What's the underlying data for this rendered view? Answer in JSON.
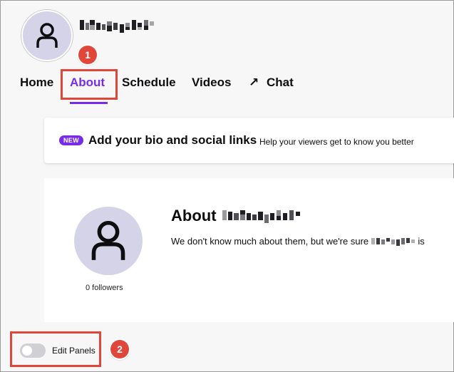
{
  "header": {
    "avatar_icon": "user-silhouette-icon",
    "channel_name": ""
  },
  "nav": {
    "tabs": [
      {
        "label": "Home"
      },
      {
        "label": "About"
      },
      {
        "label": "Schedule"
      },
      {
        "label": "Videos"
      },
      {
        "label": "Chat",
        "icon": "arrow-up-right-icon",
        "glyph": "↗"
      }
    ],
    "active_tab": "About"
  },
  "callouts": [
    {
      "number": "1"
    },
    {
      "number": "2"
    }
  ],
  "banner": {
    "pill": "NEW",
    "title": "Add your bio and social links",
    "subtitle": "Help your viewers get to know you better"
  },
  "about": {
    "title_prefix": "About",
    "description_prefix": "We don't know much about them, but we're sure",
    "description_suffix": "is",
    "followers": "0 followers",
    "avatar_icon": "user-silhouette-icon"
  },
  "edit_panels": {
    "label": "Edit Panels",
    "enabled": false
  },
  "colors": {
    "accent": "#772ce8",
    "callout": "#e0463a",
    "avatar_bg": "#d4d3e8"
  }
}
